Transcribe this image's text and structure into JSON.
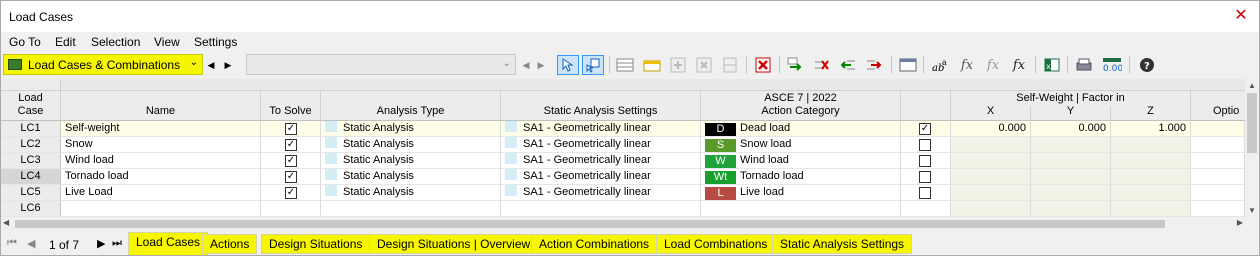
{
  "window": {
    "title": "Load Cases"
  },
  "menu": [
    "Go To",
    "Edit",
    "Selection",
    "View",
    "Settings"
  ],
  "toolbar": {
    "combo_label": "Load Cases & Combinations"
  },
  "columns": {
    "lc": "Load\nCase",
    "name": "Name",
    "to_solve": "To Solve",
    "analysis_type": "Analysis Type",
    "static_settings": "Static Analysis Settings",
    "action_category_top": "ASCE 7 | 2022",
    "action_category": "Action Category",
    "self_weight_group": "Self-Weight | Factor in",
    "x": "X",
    "y": "Y",
    "z": "Z",
    "options": "Optio"
  },
  "rows": [
    {
      "lc": "LC1",
      "name": "Self-weight",
      "to_solve": true,
      "analysis_type": "Static Analysis",
      "settings": "SA1 - Geometrically linear",
      "cat_code": "D",
      "cat_color": "#000000",
      "category": "Dead load",
      "sw": true,
      "x": "0.000",
      "y": "0.000",
      "z": "1.000"
    },
    {
      "lc": "LC2",
      "name": "Snow",
      "to_solve": true,
      "analysis_type": "Static Analysis",
      "settings": "SA1 - Geometrically linear",
      "cat_code": "S",
      "cat_color": "#5a9a2a",
      "category": "Snow load",
      "sw": false,
      "x": "",
      "y": "",
      "z": ""
    },
    {
      "lc": "LC3",
      "name": "Wind load",
      "to_solve": true,
      "analysis_type": "Static Analysis",
      "settings": "SA1 - Geometrically linear",
      "cat_code": "W",
      "cat_color": "#1fa33a",
      "category": "Wind load",
      "sw": false,
      "x": "",
      "y": "",
      "z": ""
    },
    {
      "lc": "LC4",
      "name": "Tornado load",
      "to_solve": true,
      "analysis_type": "Static Analysis",
      "settings": "SA1 - Geometrically linear",
      "cat_code": "Wt",
      "cat_color": "#17a02c",
      "category": "Tornado load",
      "sw": false,
      "x": "",
      "y": "",
      "z": ""
    },
    {
      "lc": "LC5",
      "name": "Live Load",
      "to_solve": true,
      "analysis_type": "Static Analysis",
      "settings": "SA1 - Geometrically linear",
      "cat_code": "L",
      "cat_color": "#b84a44",
      "category": "Live load",
      "sw": false,
      "x": "",
      "y": "",
      "z": ""
    },
    {
      "lc": "LC6",
      "name": "",
      "to_solve": null,
      "analysis_type": "",
      "settings": "",
      "cat_code": "",
      "cat_color": "",
      "category": "",
      "sw": null,
      "x": "",
      "y": "",
      "z": ""
    }
  ],
  "pager": {
    "text": "1 of 7"
  },
  "tabs": [
    "Load Cases",
    "Actions",
    "Design Situations",
    "Design Situations | Overview",
    "Action Combinations",
    "Load Combinations",
    "Static Analysis Settings"
  ]
}
